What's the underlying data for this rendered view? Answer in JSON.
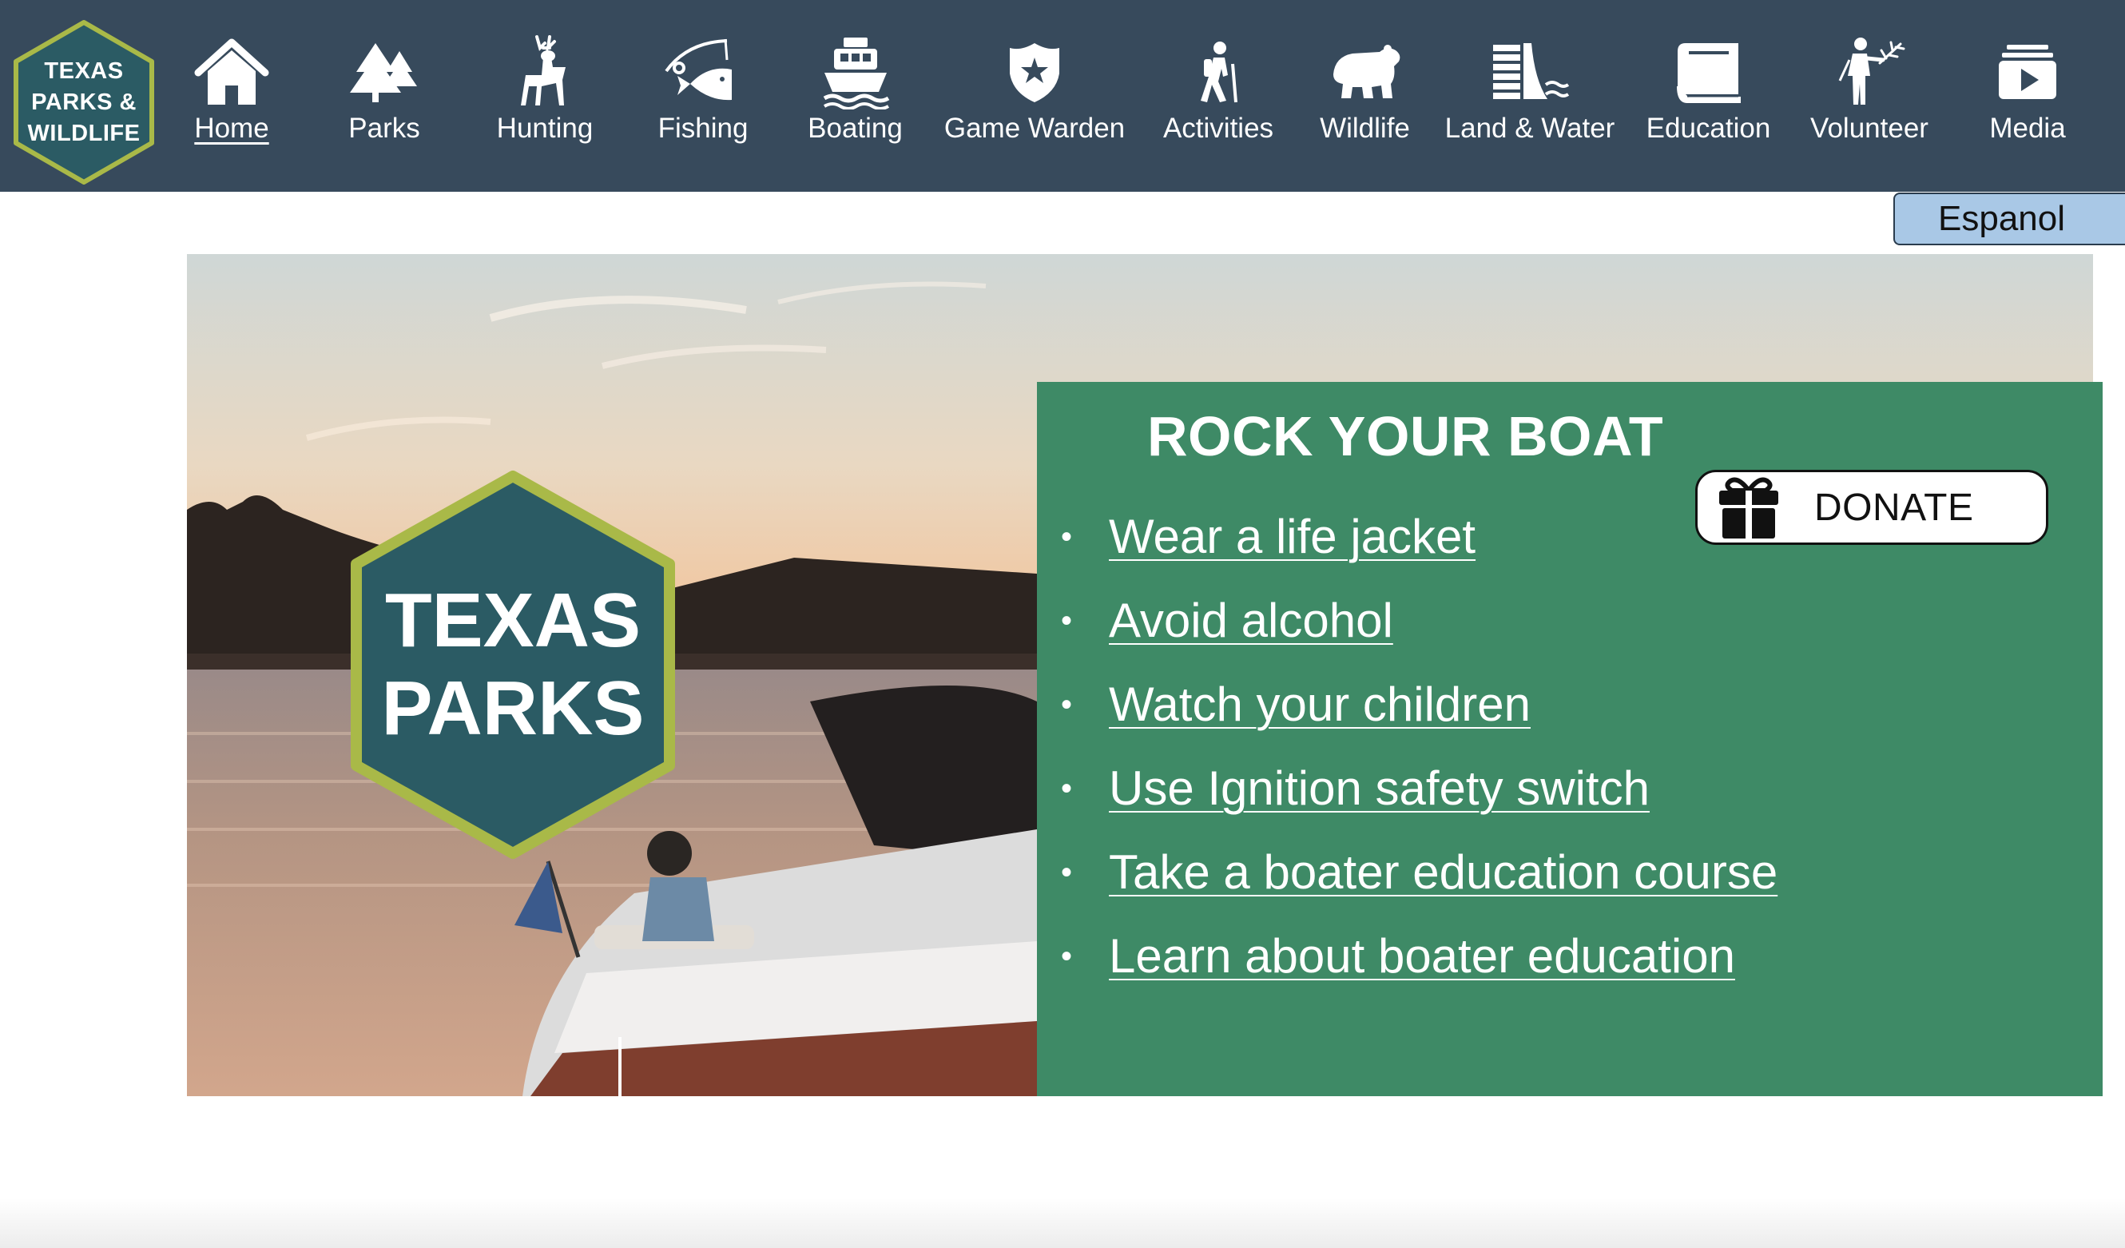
{
  "logo": {
    "lines": [
      "TEXAS",
      "PARKS &",
      "WILDLIFE"
    ],
    "colors": {
      "fill": "#2b5b64",
      "border": "#a9b948"
    }
  },
  "nav": {
    "items": [
      {
        "label": "Home",
        "icon": "home-icon",
        "active": true
      },
      {
        "label": "Parks",
        "icon": "trees-icon",
        "active": false
      },
      {
        "label": "Hunting",
        "icon": "deer-icon",
        "active": false
      },
      {
        "label": "Fishing",
        "icon": "fish-hook-icon",
        "active": false
      },
      {
        "label": "Boating",
        "icon": "boat-icon",
        "active": false
      },
      {
        "label": "Game Warden",
        "icon": "warden-badge-icon",
        "active": false
      },
      {
        "label": "Activities",
        "icon": "hiker-icon",
        "active": false
      },
      {
        "label": "Wildlife",
        "icon": "bear-icon",
        "active": false
      },
      {
        "label": "Land & Water",
        "icon": "dam-water-icon",
        "active": false
      },
      {
        "label": "Education",
        "icon": "book-icon",
        "active": false
      },
      {
        "label": "Volunteer",
        "icon": "volunteer-icon",
        "active": false
      },
      {
        "label": "Media",
        "icon": "media-play-icon",
        "active": false
      }
    ],
    "colors": {
      "background": "#374a5c",
      "text": "#ffffff"
    }
  },
  "language": {
    "label": "Espanol",
    "color": "#a9c8e6"
  },
  "hero": {
    "badge_lines": [
      "TEXAS",
      "PARKS"
    ],
    "image_subject": "sunset-lake-boat-photo"
  },
  "panel": {
    "title": "ROCK YOUR BOAT",
    "background": "#3e8a66",
    "items": [
      {
        "text": "Wear a life jacket"
      },
      {
        "text": "Avoid alcohol"
      },
      {
        "text": "Watch your children"
      },
      {
        "text": "Use Ignition safety switch"
      },
      {
        "text": "Take a boater education course"
      },
      {
        "text": "Learn about boater education"
      }
    ]
  },
  "donate": {
    "label": "DONATE",
    "icon": "gift-icon"
  }
}
